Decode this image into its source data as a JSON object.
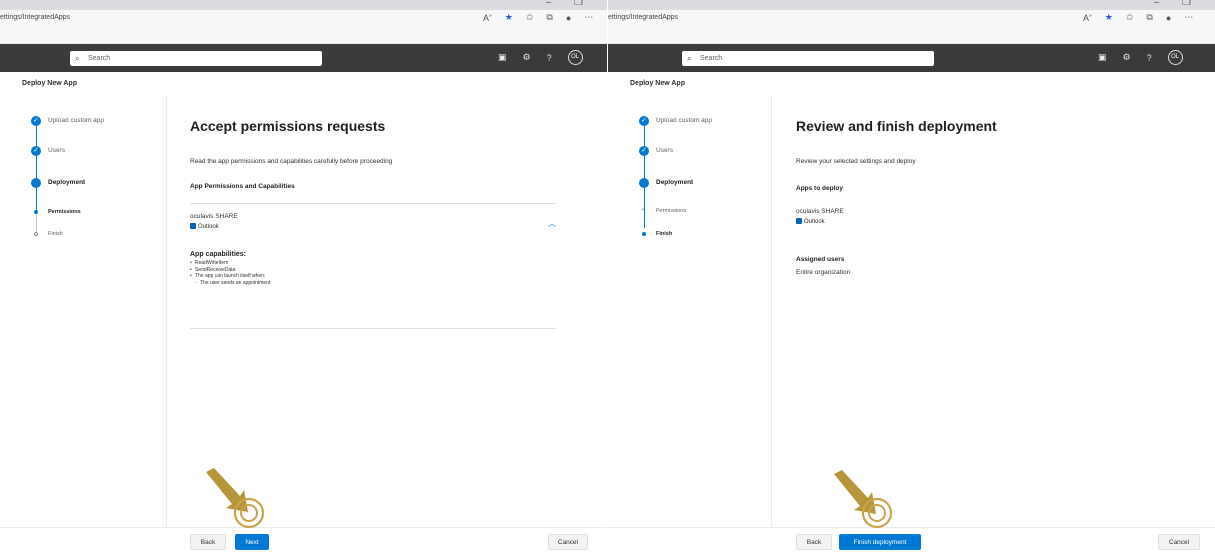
{
  "left": {
    "browser": {
      "url": "ettings/IntegratedApps",
      "window_controls": "– ❐"
    },
    "search_placeholder": "Search",
    "avatar": "OL",
    "deploy_title": "Deploy New App",
    "steps": [
      {
        "label": "Upload custom app",
        "state": "done"
      },
      {
        "label": "Users",
        "state": "done"
      },
      {
        "label": "Deployment",
        "state": "current"
      },
      {
        "label": "Permissions",
        "state": "current-sub"
      },
      {
        "label": "Finish",
        "state": "pending"
      }
    ],
    "heading": "Accept permissions requests",
    "description": "Read the app permissions and capabilities carefully before proceeding",
    "section_title": "App Permissions and Capabilities",
    "app_name": "oculavis SHARE",
    "host": "Outlook",
    "capabilities_title": "App capabilities:",
    "capabilities": [
      "ReadWriteItem",
      "SendReceiveData",
      "The app can launch itself when:"
    ],
    "capability_sub": "The user sends an appointment",
    "buttons": {
      "back": "Back",
      "next": "Next",
      "cancel": "Cancel"
    }
  },
  "right": {
    "browser": {
      "url": "ettings/IntegratedApps",
      "window_controls": "– ❐"
    },
    "search_placeholder": "Search",
    "avatar": "OL",
    "deploy_title": "Deploy New App",
    "steps": [
      {
        "label": "Upload custom app",
        "state": "done"
      },
      {
        "label": "Users",
        "state": "done"
      },
      {
        "label": "Deployment",
        "state": "current"
      },
      {
        "label": "Permissions",
        "state": "done-sub"
      },
      {
        "label": "Finish",
        "state": "current-sub"
      }
    ],
    "heading": "Review and finish deployment",
    "description": "Review your selected settings and deploy",
    "apps_title": "Apps to deploy",
    "app_name": "oculavis SHARE",
    "host": "Outlook",
    "users_title": "Assigned users",
    "users_value": "Entire organization",
    "buttons": {
      "back": "Back",
      "finish": "Finish deployment",
      "cancel": "Cancel"
    }
  },
  "colors": {
    "accent": "#0078d4",
    "header": "#3b3a39",
    "annotation": "#b8943a"
  },
  "icons": [
    "search-icon",
    "read-aloud-icon",
    "favorite-star-icon",
    "favorites-icon",
    "collections-icon",
    "profile-icon",
    "more-icon",
    "feedback-icon",
    "settings-icon",
    "help-icon",
    "checkmark-icon",
    "chevron-up-icon",
    "outlook-icon",
    "annotation-arrow-icon"
  ]
}
